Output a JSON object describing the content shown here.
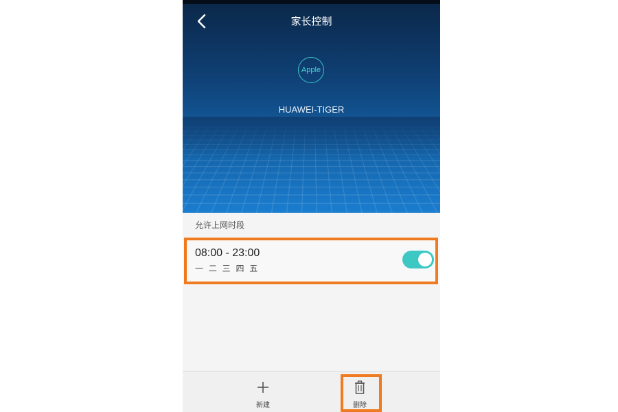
{
  "header": {
    "title": "家长控制",
    "back_icon": "chevron-left-icon"
  },
  "device": {
    "logo_text": "Apple",
    "name": "HUAWEI-TIGER"
  },
  "section": {
    "label": "允许上网时段"
  },
  "schedule": {
    "time_range": "08:00 - 23:00",
    "days": "一 二 三 四 五",
    "enabled": true
  },
  "toolbar": {
    "new_label": "新建",
    "new_icon": "plus-icon",
    "delete_label": "删除",
    "delete_icon": "trash-icon"
  },
  "colors": {
    "accent": "#3ec8c4",
    "highlight": "#f07a1f",
    "header_top": "#0b2748",
    "header_bottom": "#1a7dcf"
  }
}
